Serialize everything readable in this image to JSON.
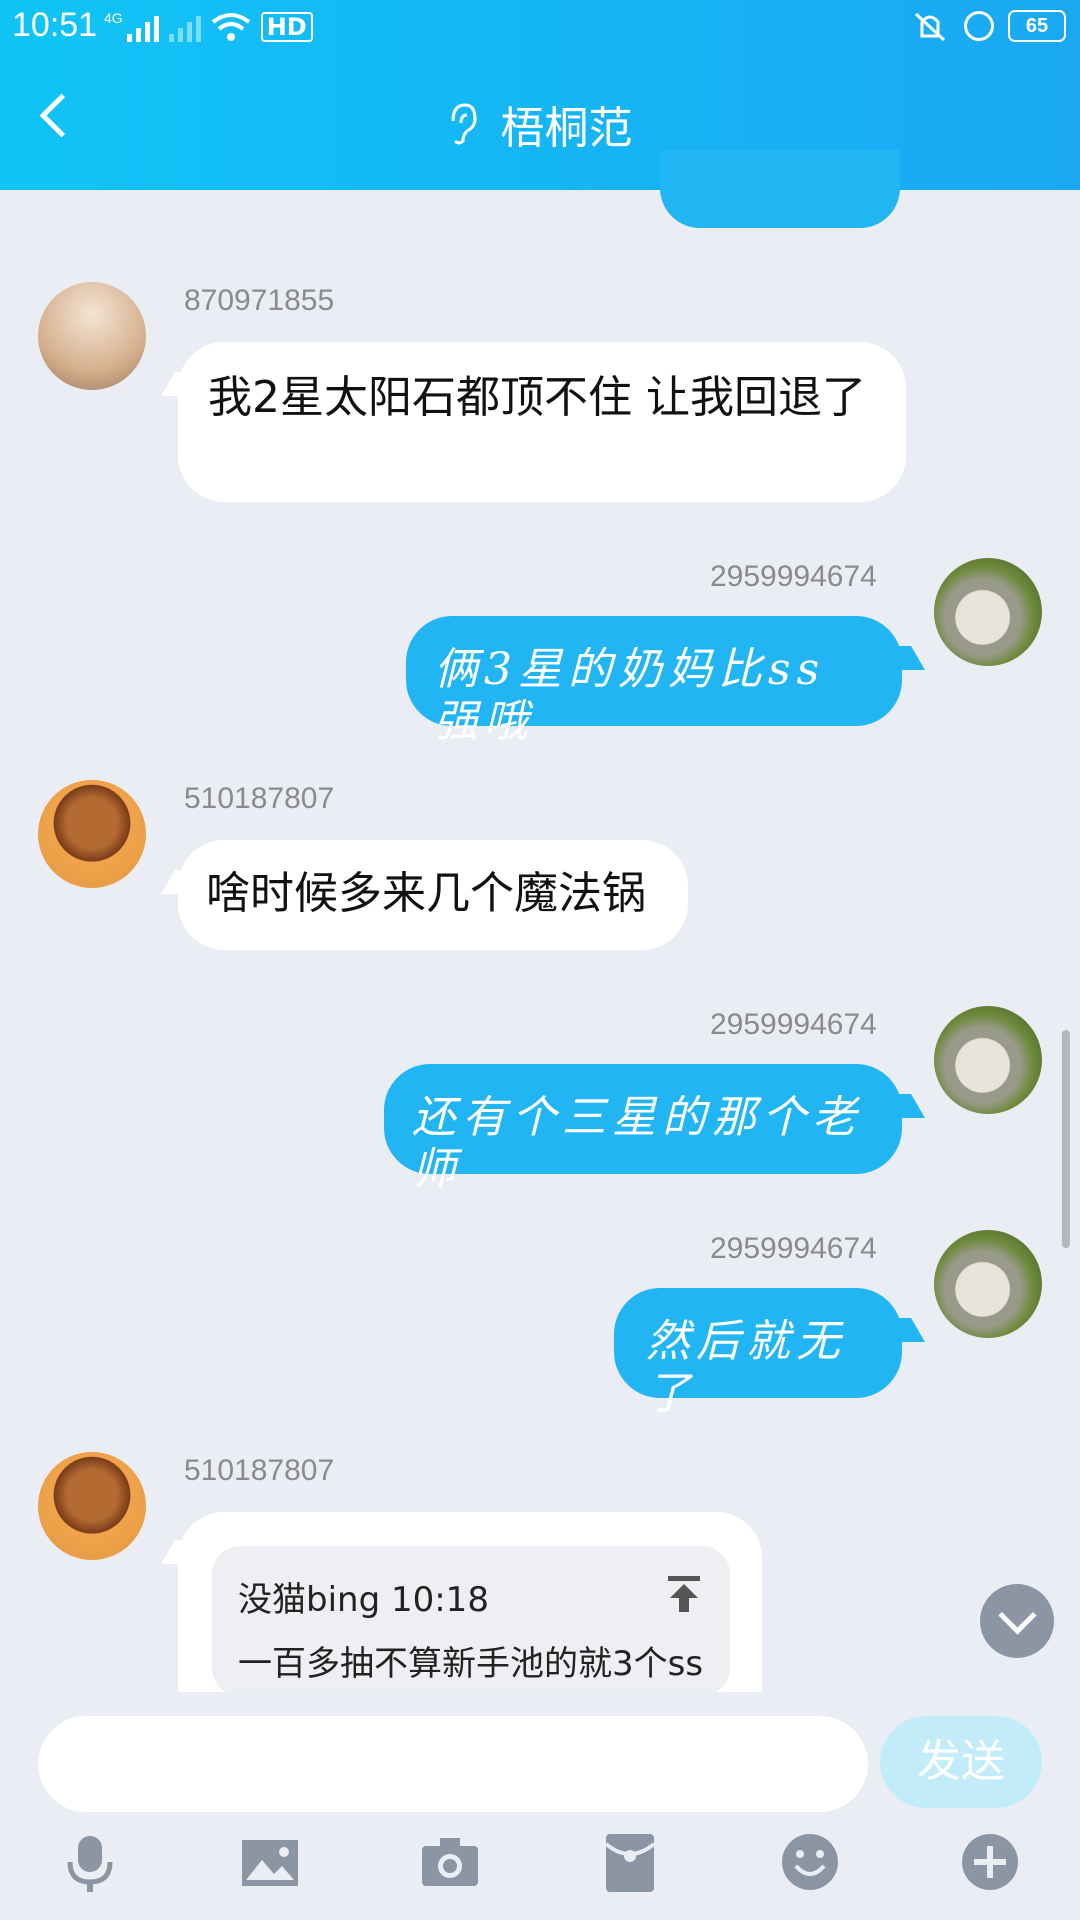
{
  "status": {
    "time": "10:51",
    "network": "4G",
    "battery": "65"
  },
  "header": {
    "title": "梧桐范"
  },
  "messages": [
    {
      "sender": "870971855",
      "text": "我2星太阳石都顶不住  让我回退了"
    },
    {
      "sender": "2959994674",
      "text": "俩3星的奶妈比ss强哦"
    },
    {
      "sender": "510187807",
      "text": "啥时候多来几个魔法锅"
    },
    {
      "sender": "2959994674",
      "text": "还有个三星的那个老师"
    },
    {
      "sender": "2959994674",
      "text": "然后就无了"
    },
    {
      "sender": "510187807",
      "quote_head": "没猫bing 10:18",
      "quote_text": "一百多抽不算新手池的就3个ss"
    }
  ],
  "input": {
    "placeholder": "",
    "send_label": "发送"
  },
  "colors": {
    "header": "#1ab2f4",
    "outgoing_bubble": "#22b5f4",
    "background": "#ebedf5",
    "send_disabled": "#c3ecfb"
  },
  "icons": [
    "back-arrow-icon",
    "ear-icon",
    "mic-icon",
    "image-icon",
    "camera-icon",
    "red-packet-icon",
    "emoji-icon",
    "plus-icon",
    "scroll-down-icon",
    "pin-icon"
  ]
}
